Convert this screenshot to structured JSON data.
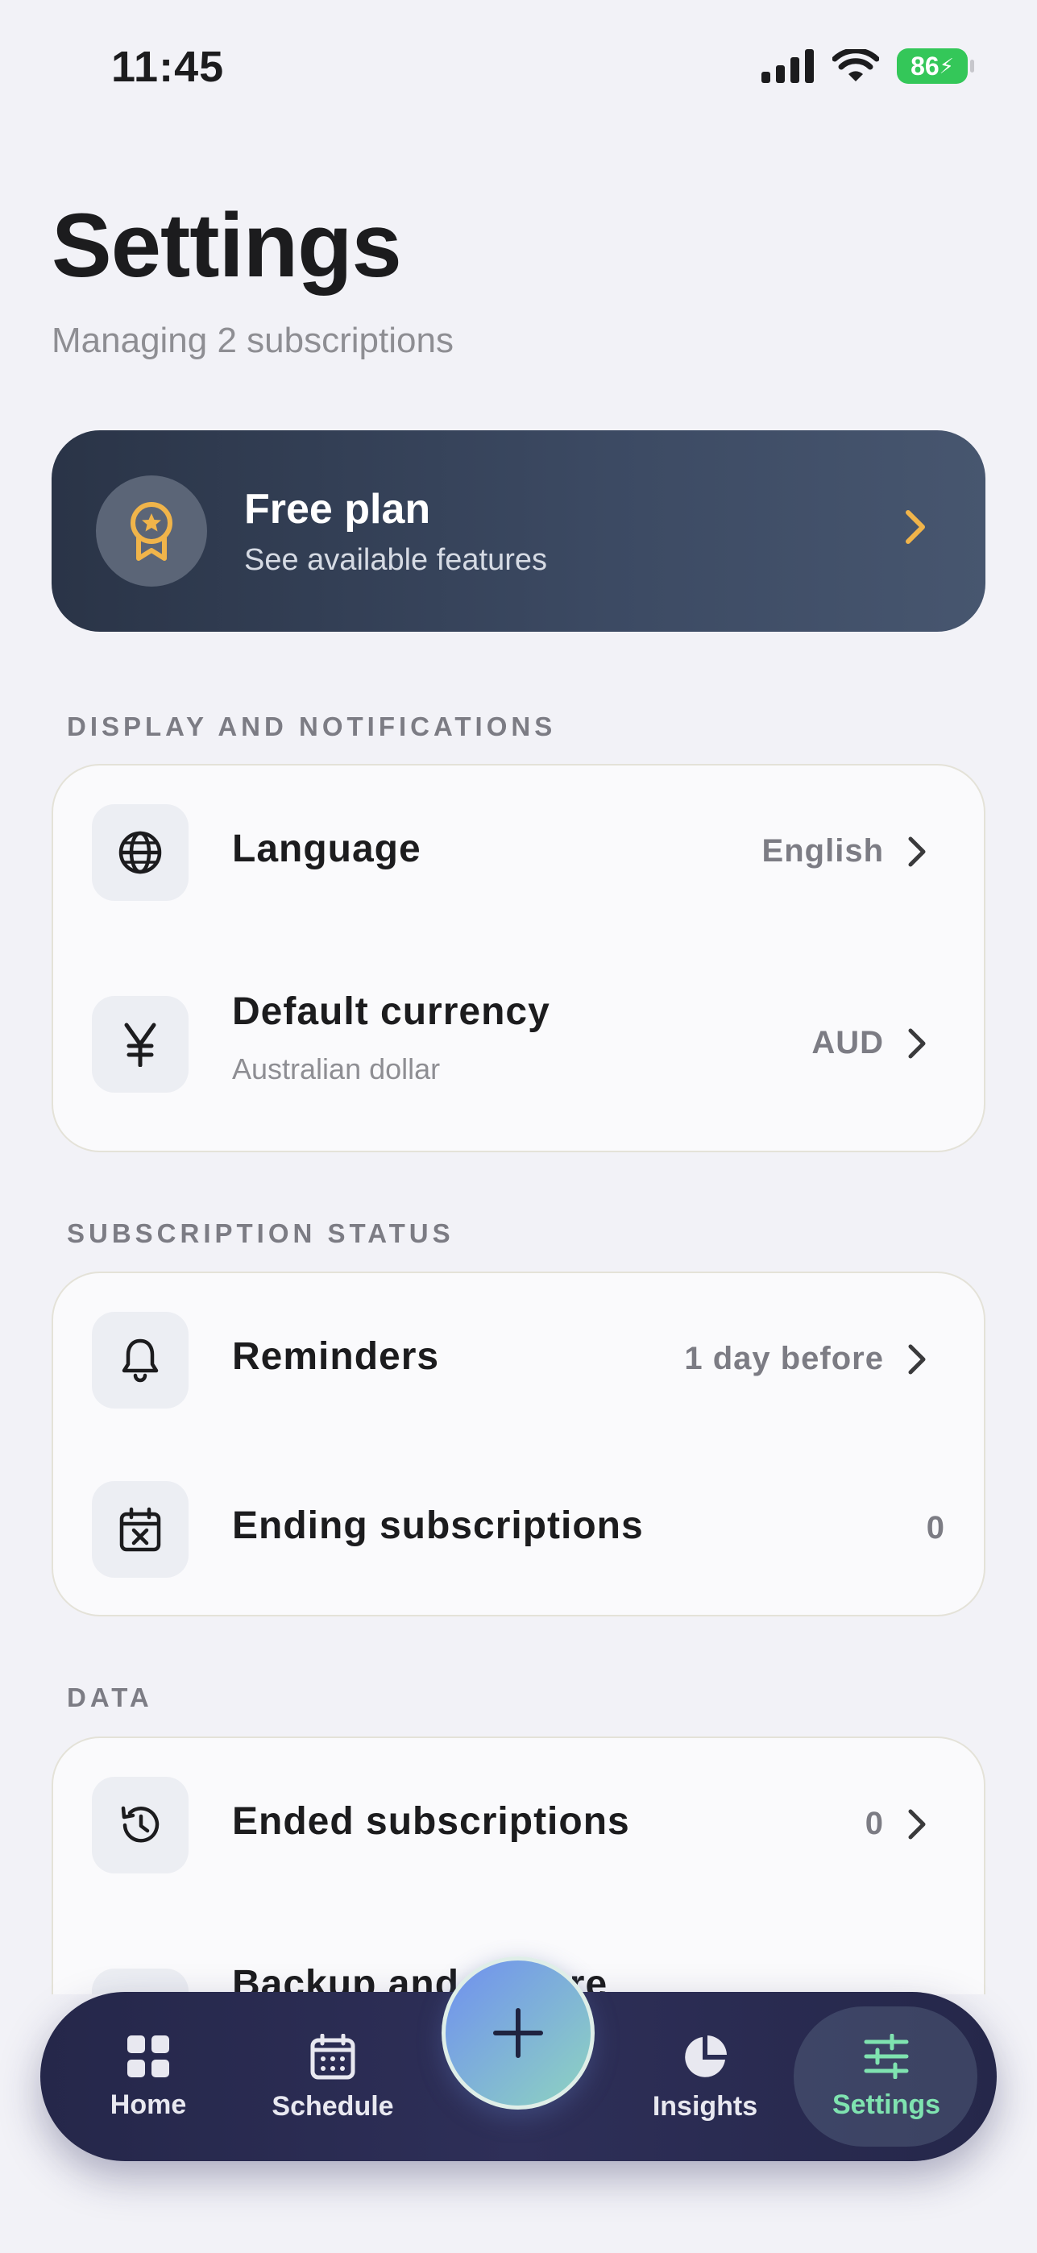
{
  "status_bar": {
    "time": "11:45",
    "battery": "86"
  },
  "header": {
    "title": "Settings",
    "subtitle": "Managing 2 subscriptions"
  },
  "plan": {
    "title": "Free plan",
    "subtitle": "See available features"
  },
  "sections": {
    "display": {
      "label": "DISPLAY AND NOTIFICATIONS",
      "language": {
        "title": "Language",
        "value": "English"
      },
      "currency": {
        "title": "Default currency",
        "subtitle": "Australian dollar",
        "value": "AUD"
      }
    },
    "status": {
      "label": "SUBSCRIPTION STATUS",
      "reminders": {
        "title": "Reminders",
        "value": "1 day before"
      },
      "ending": {
        "title": "Ending subscriptions",
        "value": "0"
      }
    },
    "data": {
      "label": "DATA",
      "ended": {
        "title": "Ended subscriptions",
        "value": "0"
      },
      "backup": {
        "title": "Backup and restore"
      }
    }
  },
  "tabbar": {
    "home": "Home",
    "schedule": "Schedule",
    "insights": "Insights",
    "settings": "Settings",
    "active_color": "#7fe3b0"
  },
  "colors": {
    "accent_gold": "#f0b44a",
    "plan_bg": "#2f3a4f"
  }
}
